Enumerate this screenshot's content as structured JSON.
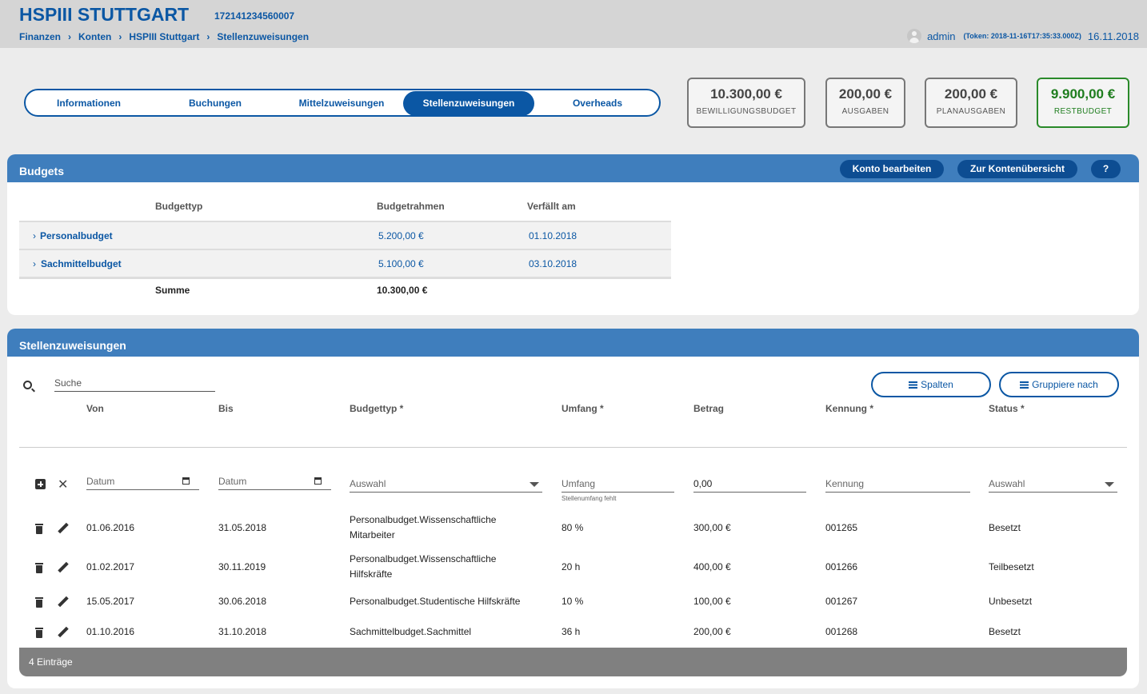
{
  "header": {
    "title": "HSPIII STUTTGART",
    "account_id": "172141234560007",
    "breadcrumb": [
      "Finanzen",
      "Konten",
      "HSPIII Stuttgart",
      "Stellenzuweisungen"
    ],
    "user": "admin",
    "token": "(Token: 2018-11-16T17:35:33.000Z)",
    "date": "16.11.2018"
  },
  "tabs": [
    "Informationen",
    "Buchungen",
    "Mittelzuweisungen",
    "Stellenzuweisungen",
    "Overheads"
  ],
  "active_tab": "Stellenzuweisungen",
  "summary": [
    {
      "value": "10.300,00 €",
      "label": "BEWILLIGUNGSBUDGET"
    },
    {
      "value": "200,00 €",
      "label": "AUSGABEN"
    },
    {
      "value": "200,00 €",
      "label": "PLANAUSGABEN"
    },
    {
      "value": "9.900,00 €",
      "label": "RESTBUDGET",
      "color": "#1e7d1e"
    }
  ],
  "budgets": {
    "title": "Budgets",
    "buttons": {
      "edit": "Konto bearbeiten",
      "overview": "Zur Kontenübersicht",
      "help": "?"
    },
    "columns": [
      "Budgettyp",
      "Budgetrahmen",
      "Verfällt am"
    ],
    "rows": [
      {
        "name": "Personalbudget",
        "amount": "5.200,00 €",
        "expires": "01.10.2018"
      },
      {
        "name": "Sachmittelbudget",
        "amount": "5.100,00 €",
        "expires": "03.10.2018"
      }
    ],
    "sum_label": "Summe",
    "sum_value": "10.300,00 €"
  },
  "assignments": {
    "title": "Stellenzuweisungen",
    "search_placeholder": "Suche",
    "btn_columns": "Spalten",
    "btn_group": "Gruppiere nach",
    "columns": [
      "Von",
      "Bis",
      "Budgettyp *",
      "Umfang *",
      "Betrag",
      "Kennung *",
      "Status *"
    ],
    "new_row": {
      "from": "Datum",
      "to": "Datum",
      "budget_type": "Auswahl",
      "scope": "Umfang",
      "scope_hint": "Stellenumfang fehlt",
      "amount": "0,00",
      "id": "Kennung",
      "status": "Auswahl"
    },
    "rows": [
      {
        "from": "01.06.2016",
        "to": "31.05.2018",
        "type_l1": "Personalbudget.Wissenschaftliche",
        "type_l2": "Mitarbeiter",
        "scope": "80 %",
        "amount": "300,00 €",
        "id": "001265",
        "status": "Besetzt"
      },
      {
        "from": "01.02.2017",
        "to": "30.11.2019",
        "type_l1": "Personalbudget.Wissenschaftliche",
        "type_l2": "Hilfskräfte",
        "scope": "20 h",
        "amount": "400,00 €",
        "id": "001266",
        "status": "Teilbesetzt"
      },
      {
        "from": "15.05.2017",
        "to": "30.06.2018",
        "type_l1": "Personalbudget.Studentische Hilfskräfte",
        "type_l2": "",
        "scope": "10 %",
        "amount": "100,00 €",
        "id": "001267",
        "status": "Unbesetzt"
      },
      {
        "from": "01.10.2016",
        "to": "31.10.2018",
        "type_l1": "Sachmittelbudget.Sachmittel",
        "type_l2": "",
        "scope": "36 h",
        "amount": "200,00 €",
        "id": "001268",
        "status": "Besetzt"
      }
    ],
    "footer": "4 Einträge"
  }
}
